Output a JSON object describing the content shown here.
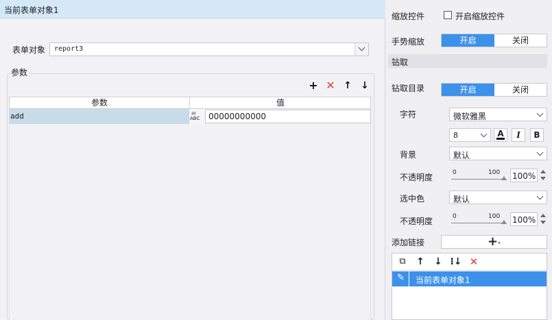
{
  "left": {
    "header_title": "当前表单对象1",
    "form_object_label": "表单对象",
    "form_object_value": "report3",
    "params_group_label": "参数",
    "table": {
      "col_param": "参数",
      "col_value": "值",
      "rows": [
        {
          "param": "add",
          "type_icon_text": "ABC",
          "value": "00000000000"
        }
      ]
    }
  },
  "right": {
    "zoom_control_label": "缩放控件",
    "enable_zoom_label": "开启缩放控件",
    "enable_zoom_checked": false,
    "gesture_zoom_label": "手势缩放",
    "on_label": "开启",
    "off_label": "关闭",
    "gesture_zoom_state": "开启",
    "drill_section": "钻取",
    "drill_directory_label": "钻取目录",
    "drill_directory_state": "开启",
    "font_label": "字符",
    "font_value": "微软雅黑",
    "font_size": "8",
    "bg_label": "背景",
    "bg_value": "默认",
    "opacity_label": "不透明度",
    "slider_min": "0",
    "slider_max": "100",
    "bg_opacity": "100%",
    "selected_color_label": "选中色",
    "selected_color_value": "默认",
    "sel_opacity": "100%",
    "add_link_label": "添加链接",
    "link_items": [
      "当前表单对象1"
    ]
  },
  "colors": {
    "accent": "#3d91ea",
    "header_bg": "#d4e8f8",
    "delete_red": "#e53935"
  }
}
